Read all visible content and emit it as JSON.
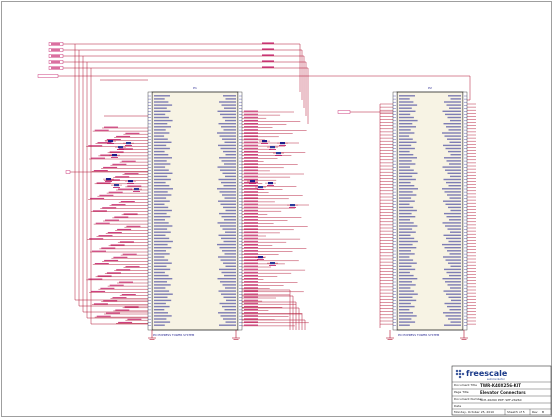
{
  "schematic": {
    "colors": {
      "wire": "#b01030",
      "net_label": "#c01060",
      "pin_text": "#1c1c8c",
      "component_fill": "#f7f3e4",
      "component_stroke": "#222222",
      "border": "#777777",
      "logo": "#1b3b8a"
    },
    "left_connector": {
      "ref_label": "P1",
      "footer_label": "PCI EXPRESS TOWER SYSTEM"
    },
    "right_connector": {
      "ref_label": "P2",
      "footer_label": "PCI EXPRESS TOWER SYSTEM"
    },
    "icons": [
      "ground-symbol",
      "capacitor-symbol",
      "resistor-symbol"
    ]
  },
  "title_block": {
    "company": "freescale",
    "company_tagline": "semiconductor",
    "fields": [
      {
        "label": "Document Title",
        "value": "TWR-K40X256-KIT"
      },
      {
        "label": "Page Title",
        "value": "Elevator Connectors"
      },
      {
        "label": "Document Number",
        "value": "SCH-26260 PDF: SPF-26260"
      },
      {
        "label": "Date",
        "value": "Monday, October 25, 2010"
      },
      {
        "label": "Sheet",
        "value": "5 of 5"
      },
      {
        "label": "Rev",
        "value": "B"
      }
    ]
  }
}
